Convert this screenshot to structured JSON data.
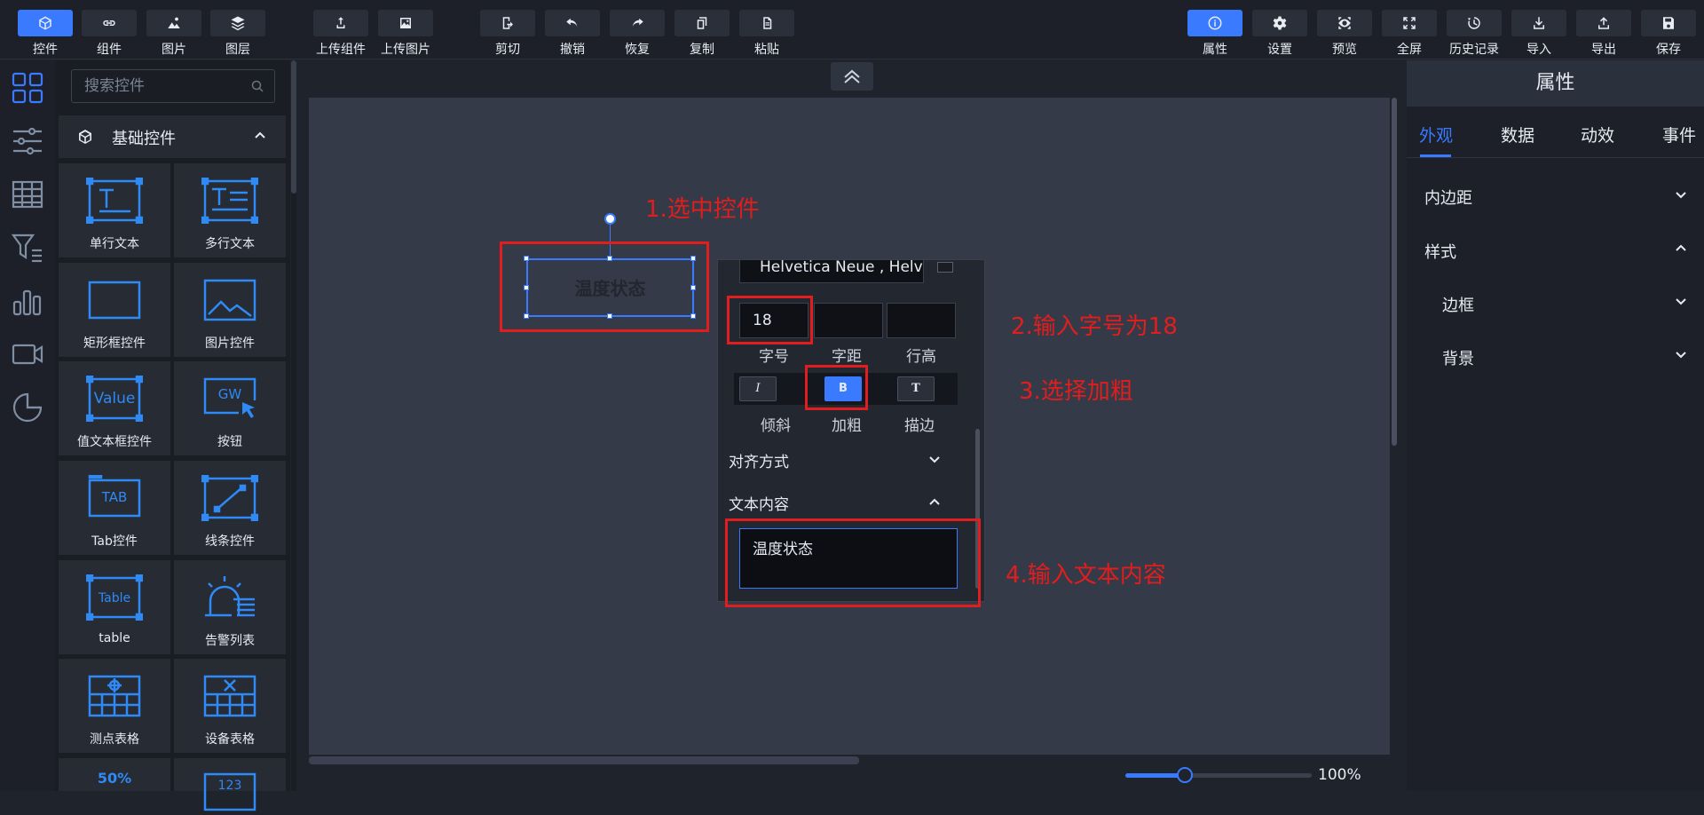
{
  "toolbar": {
    "left": [
      {
        "label": "控件",
        "icon": "cube-icon",
        "active": true
      },
      {
        "label": "组件",
        "icon": "link-icon"
      },
      {
        "label": "图片",
        "icon": "image-icon"
      },
      {
        "label": "图层",
        "icon": "layers-icon"
      }
    ],
    "upload": [
      {
        "label": "上传组件",
        "icon": "upload-component-icon"
      },
      {
        "label": "上传图片",
        "icon": "upload-image-icon"
      }
    ],
    "edit": [
      {
        "label": "剪切",
        "icon": "cut-icon"
      },
      {
        "label": "撤销",
        "icon": "undo-icon"
      },
      {
        "label": "恢复",
        "icon": "redo-icon"
      },
      {
        "label": "复制",
        "icon": "copy-icon"
      },
      {
        "label": "粘贴",
        "icon": "paste-icon"
      }
    ],
    "right": [
      {
        "label": "属性",
        "icon": "info-icon",
        "active": true
      },
      {
        "label": "设置",
        "icon": "gear-icon"
      },
      {
        "label": "预览",
        "icon": "eye-icon"
      },
      {
        "label": "全屏",
        "icon": "fullscreen-icon"
      },
      {
        "label": "历史记录",
        "icon": "history-icon"
      },
      {
        "label": "导入",
        "icon": "import-icon"
      },
      {
        "label": "导出",
        "icon": "export-icon"
      },
      {
        "label": "保存",
        "icon": "save-icon"
      }
    ]
  },
  "search": {
    "placeholder": "搜索控件"
  },
  "category": {
    "label": "基础控件"
  },
  "widgets": [
    {
      "label": "单行文本",
      "icon": "single-text-icon"
    },
    {
      "label": "多行文本",
      "icon": "multi-text-icon"
    },
    {
      "label": "矩形框控件",
      "icon": "rectangle-icon"
    },
    {
      "label": "图片控件",
      "icon": "picture-icon"
    },
    {
      "label": "值文本框控件",
      "icon": "value-box-icon",
      "glyph": "Value"
    },
    {
      "label": "按钮",
      "icon": "button-icon",
      "glyph": "GW"
    },
    {
      "label": "Tab控件",
      "icon": "tab-icon",
      "glyph": "TAB"
    },
    {
      "label": "线条控件",
      "icon": "line-icon"
    },
    {
      "label": "table",
      "icon": "table-icon",
      "glyph": "Table"
    },
    {
      "label": "告警列表",
      "icon": "alarm-list-icon"
    },
    {
      "label": "测点表格",
      "icon": "measure-table-icon"
    },
    {
      "label": "设备表格",
      "icon": "device-table-icon"
    },
    {
      "label": "",
      "icon": "percent-icon",
      "glyph": "50%"
    },
    {
      "label": "",
      "icon": "number-icon",
      "glyph": "123"
    }
  ],
  "canvas": {
    "widget_text": "温度状态",
    "zoom": "100%",
    "zoom_fraction": 0.32
  },
  "annotations": {
    "step1": "1.选中控件",
    "step2": "2.输入字号为18",
    "step3": "3.选择加粗",
    "step4": "4.输入文本内容"
  },
  "popover": {
    "font_family": "Helvetica Neue , Helv",
    "font_size": "18",
    "letter_spacing": "",
    "line_height": "",
    "font_size_label": "字号",
    "letter_spacing_label": "字距",
    "line_height_label": "行高",
    "italic_glyph": "I",
    "bold_glyph": "B",
    "stroke_glyph": "T",
    "italic_label": "倾斜",
    "bold_label": "加粗",
    "stroke_label": "描边",
    "align_label": "对齐方式",
    "text_content_label": "文本内容",
    "text_content_value": "温度状态"
  },
  "right_panel": {
    "title": "属性",
    "tabs": [
      "外观",
      "数据",
      "动效",
      "事件"
    ],
    "padding": "内边距",
    "style": "样式",
    "border": "边框",
    "background": "背景"
  },
  "colors": {
    "accent": "#3a7afe",
    "annotation": "#e21d1d",
    "widget_blue": "#2f8af5"
  }
}
